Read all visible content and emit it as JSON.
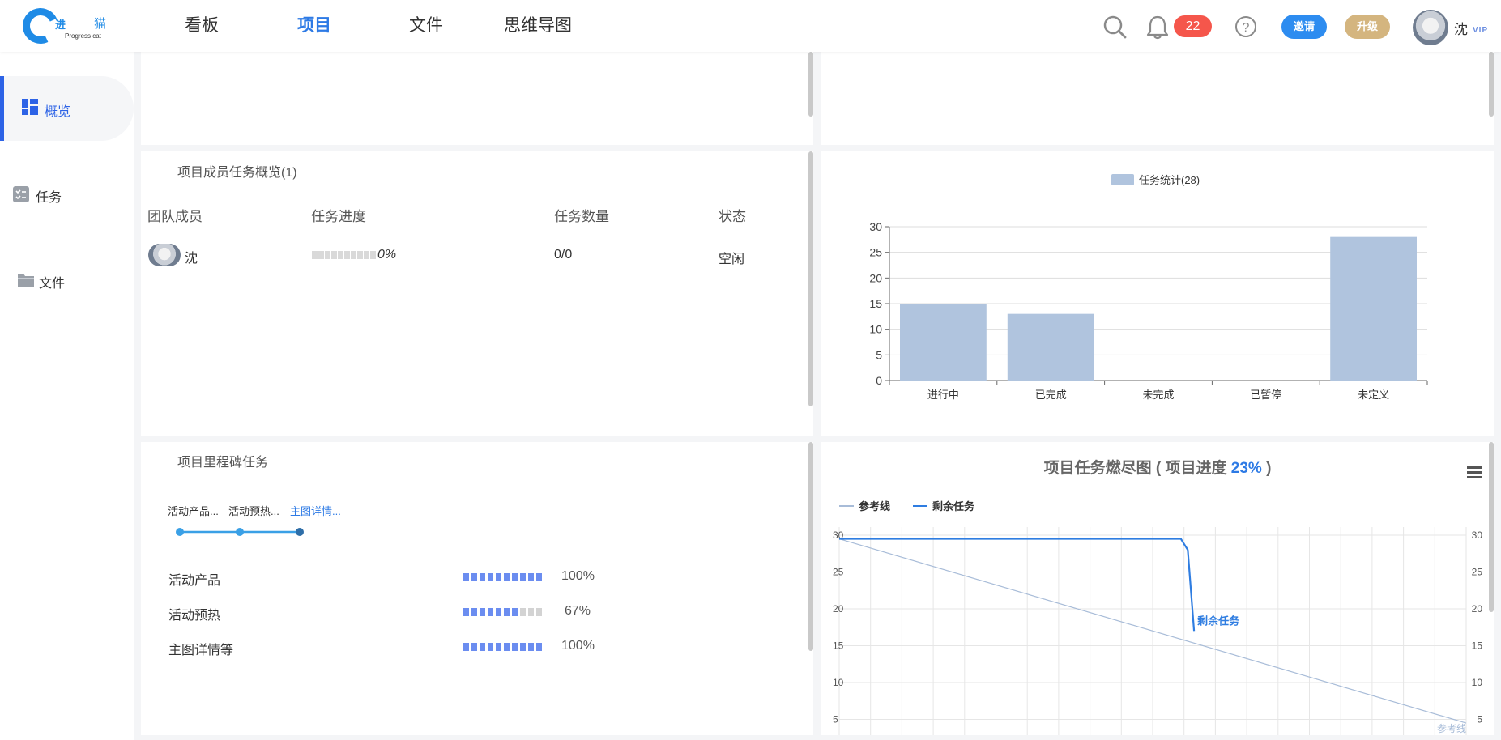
{
  "header": {
    "logo": {
      "text_cn_1": "进",
      "text_cn_2": "猫",
      "text_en": "Progress cat"
    },
    "nav": [
      {
        "label": "看板",
        "active": false
      },
      {
        "label": "项目",
        "active": true
      },
      {
        "label": "文件",
        "active": false
      },
      {
        "label": "思维导图",
        "active": false
      }
    ],
    "notification_count": "22",
    "invite_label": "邀请",
    "upgrade_label": "升级",
    "user_name": "沈",
    "vip_label": "VIP",
    "accent": "#2d7ae5"
  },
  "sidebar": {
    "items": [
      {
        "label": "概览",
        "active": true
      },
      {
        "label": "任务",
        "active": false
      },
      {
        "label": "文件",
        "active": false
      }
    ]
  },
  "members": {
    "title": "项目成员任务概览(1)",
    "columns": [
      "团队成员",
      "任务进度",
      "任务数量",
      "状态"
    ],
    "rows": [
      {
        "name": "沈",
        "progress": "0%",
        "progress_value": 0,
        "count": "0/0",
        "status": "空闲"
      }
    ]
  },
  "milestones": {
    "title": "项目里程碑任务",
    "timeline": [
      "活动产品...",
      "活动预热...",
      "主图详情..."
    ],
    "items": [
      {
        "name": "活动产品",
        "pct": "100%",
        "value": 1.0
      },
      {
        "name": "活动预热",
        "pct": "67%",
        "value": 0.67
      },
      {
        "name": "主图详情等",
        "pct": "100%",
        "value": 1.0
      }
    ]
  },
  "chart_data": [
    {
      "type": "bar",
      "title": "",
      "legend": "任务统计(28)",
      "legend_position": "top-center",
      "categories": [
        "进行中",
        "已完成",
        "未完成",
        "已暂停",
        "未定义"
      ],
      "values": [
        15,
        13,
        0,
        0,
        28
      ],
      "ylim": [
        0,
        30
      ],
      "yticks": [
        0,
        5,
        10,
        15,
        20,
        25,
        30
      ],
      "color": "#b0c4de",
      "grid": true
    },
    {
      "type": "line",
      "title_prefix": "项目任务燃尽图 ( 项目进度 ",
      "title_value": "23%",
      "title_suffix": " )",
      "legend_position": "top-left",
      "series": [
        {
          "name": "参考线",
          "color": "#a8bcd8",
          "points": [
            [
              0,
              29.5
            ],
            [
              1,
              4.5
            ]
          ]
        },
        {
          "name": "剩余任务",
          "color": "#2f7de1",
          "points": [
            [
              0,
              29.5
            ],
            [
              0.545,
              29.5
            ],
            [
              0.556,
              28
            ],
            [
              0.566,
              17
            ]
          ]
        }
      ],
      "series_labels": [
        "剩余任务",
        "参考线"
      ],
      "yticks": [
        5,
        10,
        15,
        20,
        25,
        30
      ],
      "ylim": [
        5,
        30
      ],
      "grid": true
    }
  ]
}
